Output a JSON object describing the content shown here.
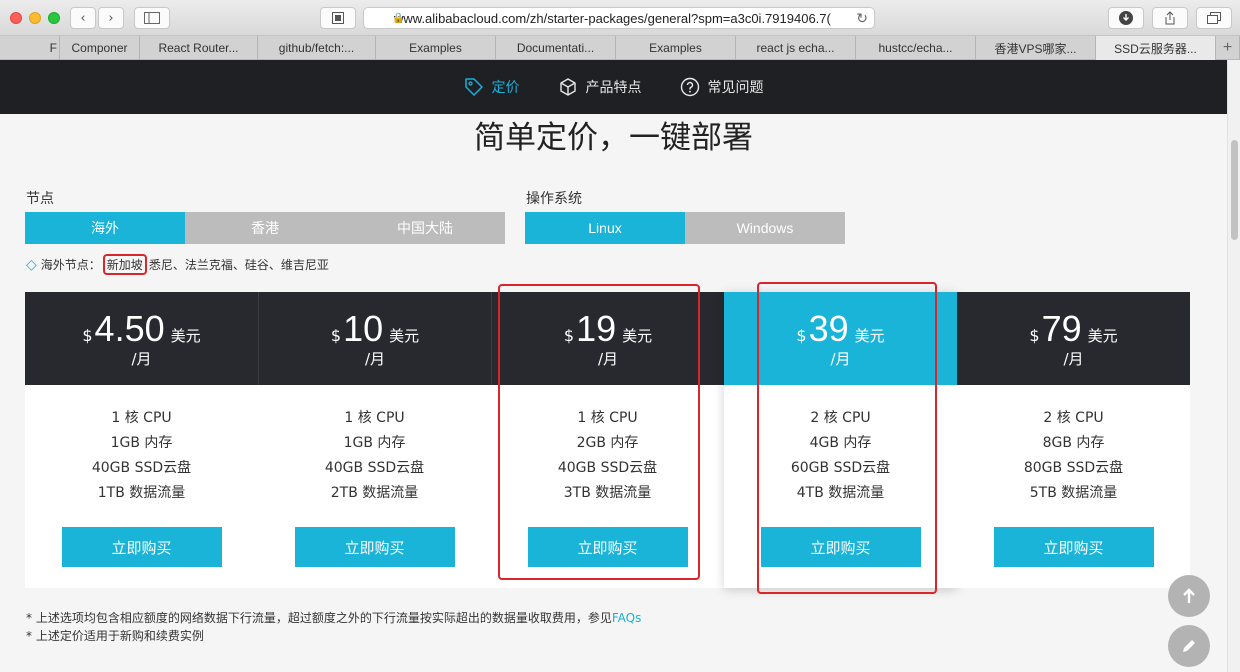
{
  "browser": {
    "url": "www.alibabacloud.com/zh/starter-packages/general?spm=a3c0i.7919406.7(",
    "tabs": [
      "F",
      "Componer",
      "React Router...",
      "github/fetch:...",
      "Examples",
      "Documentati...",
      "Examples",
      "react js echa...",
      "hustcc/echa...",
      "香港VPS哪家...",
      "SSD云服务器..."
    ],
    "new_tab": "+"
  },
  "nav": {
    "pricing": "定价",
    "features": "产品特点",
    "faq": "常见问题"
  },
  "page_title": "简单定价，一键部署",
  "node": {
    "label": "节点",
    "options": [
      "海外",
      "香港",
      "中国大陆"
    ],
    "selected": "海外",
    "note_prefix": "海外节点：",
    "note_highlight": "新加坡",
    "note_rest": "悉尼、法兰克福、硅谷、维吉尼亚"
  },
  "os": {
    "label": "操作系统",
    "options": [
      "Linux",
      "Windows"
    ],
    "selected": "Linux"
  },
  "plans": [
    {
      "currency": "$",
      "price": "4.50",
      "unit": "美元",
      "period": "/月",
      "specs": [
        "1 核 CPU",
        "1GB 内存",
        "40GB SSD云盘",
        "1TB 数据流量"
      ],
      "button": "立即购买"
    },
    {
      "currency": "$",
      "price": "10",
      "unit": "美元",
      "period": "/月",
      "specs": [
        "1 核 CPU",
        "1GB 内存",
        "40GB SSD云盘",
        "2TB 数据流量"
      ],
      "button": "立即购买"
    },
    {
      "currency": "$",
      "price": "19",
      "unit": "美元",
      "period": "/月",
      "specs": [
        "1 核 CPU",
        "2GB 内存",
        "40GB SSD云盘",
        "3TB 数据流量"
      ],
      "button": "立即购买"
    },
    {
      "currency": "$",
      "price": "39",
      "unit": "美元",
      "period": "/月",
      "specs": [
        "2 核 CPU",
        "4GB 内存",
        "60GB SSD云盘",
        "4TB 数据流量"
      ],
      "button": "立即购买"
    },
    {
      "currency": "$",
      "price": "79",
      "unit": "美元",
      "period": "/月",
      "specs": [
        "2 核 CPU",
        "8GB 内存",
        "80GB SSD云盘",
        "5TB 数据流量"
      ],
      "button": "立即购买"
    }
  ],
  "footnotes": {
    "line1": "* 上述选项均包含相应额度的网络数据下行流量，超过额度之外的下行流量按实际超出的数据量收取费用，参见",
    "faq_link": "FAQs",
    "line2": "* 上述定价适用于新购和续费实例"
  },
  "colors": {
    "accent": "#19b4d8",
    "dark": "#27292e",
    "annotation": "#d9262b"
  }
}
